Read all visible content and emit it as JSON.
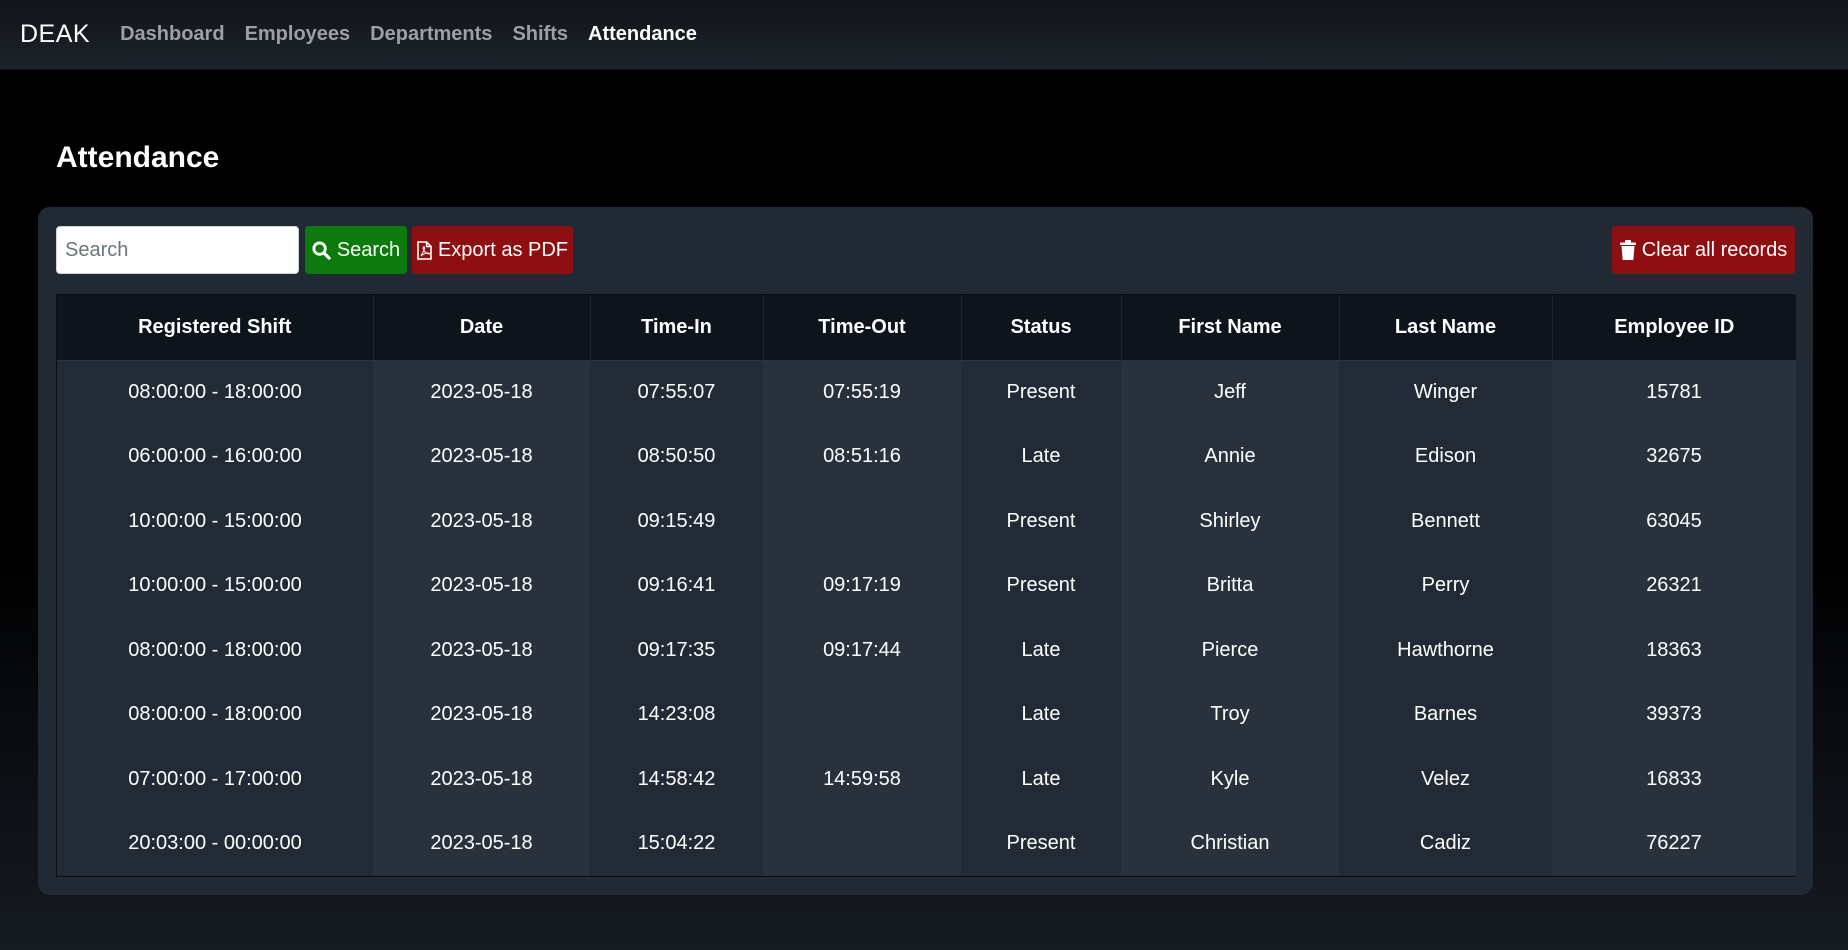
{
  "navbar": {
    "brand": "DEAK",
    "items": [
      {
        "label": "Dashboard",
        "active": false
      },
      {
        "label": "Employees",
        "active": false
      },
      {
        "label": "Departments",
        "active": false
      },
      {
        "label": "Shifts",
        "active": false
      },
      {
        "label": "Attendance",
        "active": true
      }
    ]
  },
  "page": {
    "title": "Attendance"
  },
  "toolbar": {
    "search_placeholder": "Search",
    "search_label": "Search",
    "export_label": "Export as PDF",
    "clear_label": "Clear all records"
  },
  "colors": {
    "search_button": "#0c7a0c",
    "danger_button": "#8e0f12"
  },
  "icons": {
    "search": "search-icon",
    "pdf": "file-pdf-icon",
    "trash": "trash-icon"
  },
  "table": {
    "columns": [
      "Registered Shift",
      "Date",
      "Time-In",
      "Time-Out",
      "Status",
      "First Name",
      "Last Name",
      "Employee ID"
    ],
    "rows": [
      [
        "08:00:00 - 18:00:00",
        "2023-05-18",
        "07:55:07",
        "07:55:19",
        "Present",
        "Jeff",
        "Winger",
        "15781"
      ],
      [
        "06:00:00 - 16:00:00",
        "2023-05-18",
        "08:50:50",
        "08:51:16",
        "Late",
        "Annie",
        "Edison",
        "32675"
      ],
      [
        "10:00:00 - 15:00:00",
        "2023-05-18",
        "09:15:49",
        "",
        "Present",
        "Shirley",
        "Bennett",
        "63045"
      ],
      [
        "10:00:00 - 15:00:00",
        "2023-05-18",
        "09:16:41",
        "09:17:19",
        "Present",
        "Britta",
        "Perry",
        "26321"
      ],
      [
        "08:00:00 - 18:00:00",
        "2023-05-18",
        "09:17:35",
        "09:17:44",
        "Late",
        "Pierce",
        "Hawthorne",
        "18363"
      ],
      [
        "08:00:00 - 18:00:00",
        "2023-05-18",
        "14:23:08",
        "",
        "Late",
        "Troy",
        "Barnes",
        "39373"
      ],
      [
        "07:00:00 - 17:00:00",
        "2023-05-18",
        "14:58:42",
        "14:59:58",
        "Late",
        "Kyle",
        "Velez",
        "16833"
      ],
      [
        "20:03:00 - 00:00:00",
        "2023-05-18",
        "15:04:22",
        "",
        "Present",
        "Christian",
        "Cadiz",
        "76227"
      ]
    ]
  }
}
